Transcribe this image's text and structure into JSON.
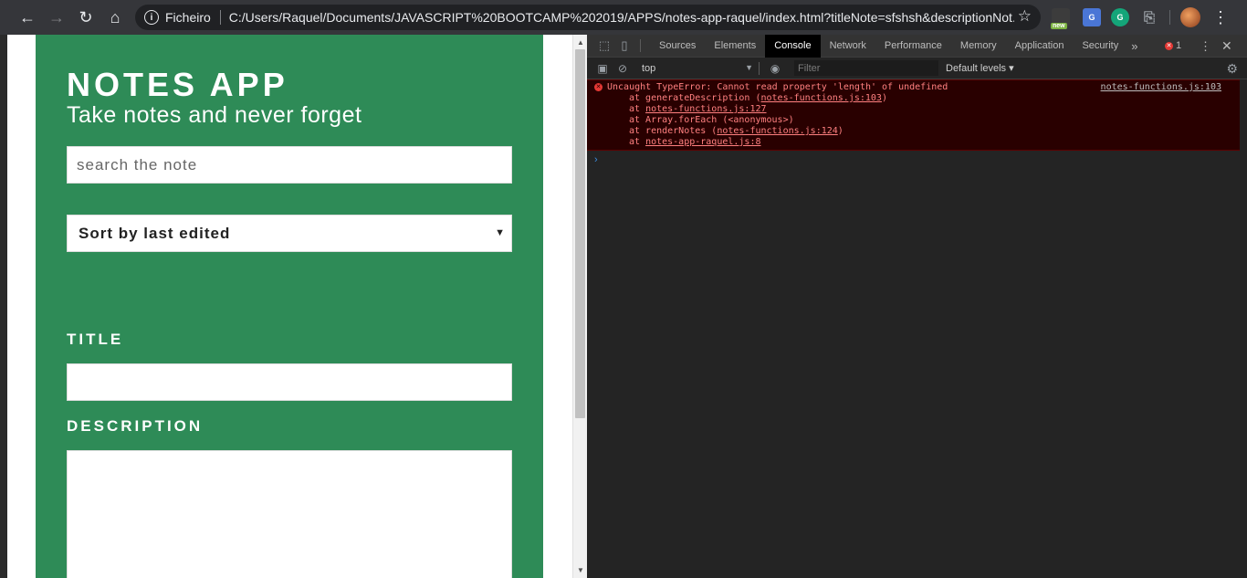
{
  "browser": {
    "back_icon": "back-arrow-icon",
    "forward_icon": "forward-arrow-icon",
    "reload_icon": "reload-icon",
    "home_icon": "home-icon",
    "scheme_label": "Ficheiro",
    "url": "C:/Users/Raquel/Documents/JAVASCRIPT%20BOOTCAMP%202019/APPS/notes-app-raquel/index.html?titleNote=sfshsh&descriptionNot...",
    "ext_new_label": "new"
  },
  "app": {
    "title": "NOTES APP",
    "subtitle": "Take notes and never forget",
    "search_placeholder": "search the note",
    "sort_value": "Sort by last edited",
    "title_label": "TITLE",
    "description_label": "DESCRIPTION",
    "accent_color": "#2e8b57"
  },
  "devtools": {
    "tabs": [
      "Sources",
      "Elements",
      "Console",
      "Network",
      "Performance",
      "Memory",
      "Application",
      "Security"
    ],
    "active_tab": "Console",
    "error_count": "1",
    "context": "top",
    "filter_placeholder": "Filter",
    "levels": "Default levels",
    "error": {
      "message": "Uncaught TypeError: Cannot read property 'length' of undefined",
      "source": "notes-functions.js:103",
      "stack": [
        {
          "prefix": "at generateDescription (",
          "link": "notes-functions.js:103",
          "suffix": ")"
        },
        {
          "prefix": "at ",
          "link": "notes-functions.js:127",
          "suffix": ""
        },
        {
          "prefix": "at Array.forEach (<anonymous>)",
          "link": "",
          "suffix": ""
        },
        {
          "prefix": "at renderNotes (",
          "link": "notes-functions.js:124",
          "suffix": ")"
        },
        {
          "prefix": "at ",
          "link": "notes-app-raquel.js:8",
          "suffix": ""
        }
      ]
    }
  }
}
